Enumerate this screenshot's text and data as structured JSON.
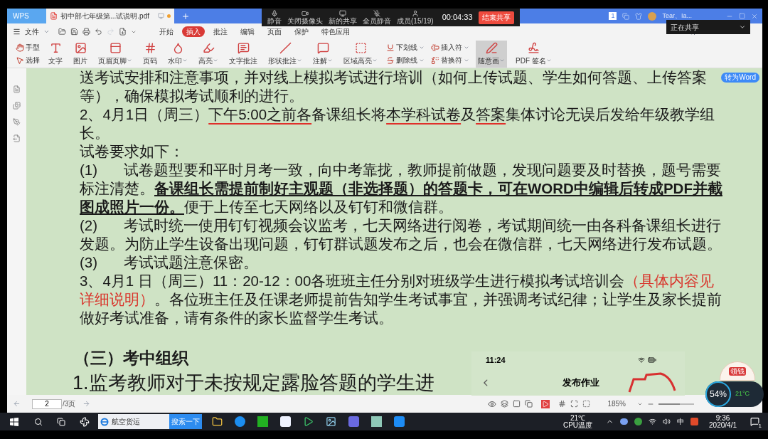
{
  "tabs": [
    {
      "kind": "brand",
      "label": "WPS",
      "selected": false
    },
    {
      "kind": "document",
      "label": "初中部七年级第...试说明.pdf",
      "selected": true
    }
  ],
  "title_bar": {
    "badge": "1",
    "user": "Tear、Ia..."
  },
  "meeting_bar": {
    "items": [
      "静音",
      "关闭摄像头",
      "新的共享",
      "全员静音",
      "成员(15/19)"
    ],
    "timer": "00:04:33",
    "end_button": "结束共享",
    "sharing_label": "正在共享"
  },
  "menu": {
    "file": "文件",
    "items": [
      {
        "label": "开始",
        "selected": false
      },
      {
        "label": "插入",
        "selected": true
      },
      {
        "label": "批注",
        "selected": false
      },
      {
        "label": "编辑",
        "selected": false
      },
      {
        "label": "页面",
        "selected": false
      },
      {
        "label": "保护",
        "selected": false
      },
      {
        "label": "特色应用",
        "selected": false
      }
    ]
  },
  "toolbar": [
    {
      "kind": "stack",
      "items": [
        {
          "label": "手型",
          "dropdown": false
        },
        {
          "label": "选择",
          "dropdown": false
        }
      ]
    },
    {
      "kind": "large",
      "label": "文字",
      "dropdown": false,
      "selected": false
    },
    {
      "kind": "large",
      "label": "图片",
      "dropdown": false,
      "selected": false
    },
    {
      "kind": "large",
      "label": "页眉页脚",
      "dropdown": true,
      "selected": false
    },
    {
      "kind": "large",
      "label": "页码",
      "dropdown": false,
      "selected": false
    },
    {
      "kind": "large",
      "label": "水印",
      "dropdown": true,
      "selected": false
    },
    {
      "kind": "large",
      "label": "高亮",
      "dropdown": true,
      "selected": false
    },
    {
      "kind": "large",
      "label": "文字批注",
      "dropdown": false,
      "selected": false
    },
    {
      "kind": "large",
      "label": "形状批注",
      "dropdown": true,
      "selected": false
    },
    {
      "kind": "large",
      "label": "注解",
      "dropdown": true,
      "selected": false
    },
    {
      "kind": "large",
      "label": "区域高亮",
      "dropdown": true,
      "selected": false
    },
    {
      "kind": "stack",
      "items": [
        {
          "label": "下划线",
          "dropdown": true
        },
        {
          "label": "删除线",
          "dropdown": true
        }
      ]
    },
    {
      "kind": "stack",
      "items": [
        {
          "label": "插入符",
          "dropdown": true
        },
        {
          "label": "替换符",
          "dropdown": true
        }
      ]
    },
    {
      "kind": "large",
      "label": "随意画",
      "dropdown": true,
      "selected": true
    },
    {
      "kind": "large",
      "label": "PDF 签名",
      "dropdown": true,
      "selected": false
    }
  ],
  "convert_button": "转为Word",
  "document": {
    "paragraphs": [
      {
        "kind": "body",
        "segments": [
          {
            "text": "送考试安排和注意事项，并对线上模拟考试进行培训（如何上传试题、学生如何答题、上传答案等），确保模拟考试顺利的进行。",
            "kind": "plain"
          }
        ]
      },
      {
        "kind": "body",
        "segments": [
          {
            "text": "2、4月1日（周三）",
            "kind": "plain"
          },
          {
            "text": "下午5:00之前各",
            "kind": "marked"
          },
          {
            "text": "备课组长将",
            "kind": "plain"
          },
          {
            "text": "本学科试卷",
            "kind": "marked"
          },
          {
            "text": "及",
            "kind": "plain"
          },
          {
            "text": "答案",
            "kind": "marked"
          },
          {
            "text": "集体讨论无误后发给年级教学组长。",
            "kind": "plain"
          }
        ]
      },
      {
        "kind": "body",
        "segments": [
          {
            "text": "试卷要求如下：",
            "kind": "plain"
          }
        ]
      },
      {
        "kind": "item",
        "number": "(1)",
        "segments": [
          {
            "text": "试卷题型要和平时月考一致，向中考靠拢，教师提前做题，发现问题要及时替换，题号需要标注清楚。",
            "kind": "plain"
          },
          {
            "text": "备课组长需提前制好主观题（非选择题）的答题卡，可在WORD中编辑后转成PDF并截图成照片一份。",
            "kind": "bold"
          },
          {
            "text": "便于上传至七天网络以及钉钉和微信群。",
            "kind": "plain"
          }
        ]
      },
      {
        "kind": "item",
        "number": "(2)",
        "segments": [
          {
            "text": "考试时统一使用钉钉视频会议监考，七天网络进行阅卷，考试期间统一由各科备课组长进行发题。为防止学生设备出现问题，钉钉群试题发布之后，也会在微信群，七天网络进行发布试题。",
            "kind": "plain"
          }
        ]
      },
      {
        "kind": "item",
        "number": "(3)",
        "segments": [
          {
            "text": "考试试题注意保密。",
            "kind": "plain"
          }
        ]
      },
      {
        "kind": "body",
        "segments": [
          {
            "text": "3、4月1 日（周三）11：20-12：00各班班主任分别对班级学生进行模拟考试培训会",
            "kind": "plain"
          },
          {
            "text": "（具体内容见详细说明）",
            "kind": "red"
          },
          {
            "text": "。各位班主任及任课老师提前告知学生考试事宜，并强调考试纪律；让学生及家长提前做好考试准备，请有条件的家长监督学生考试。",
            "kind": "plain"
          }
        ]
      },
      {
        "kind": "heading",
        "segments": [
          {
            "text": "（三）考中组织",
            "kind": "plain"
          }
        ]
      },
      {
        "kind": "large",
        "segments": [
          {
            "text": "1.监考教师对于未按规定露脸答题的学生进",
            "kind": "plain"
          }
        ]
      }
    ]
  },
  "phone_overlay": {
    "time": "11:24",
    "title": "发布作业"
  },
  "widgets": {
    "gift_label": "领钱",
    "cpu_load": "54%",
    "cpu_temp": "21°C"
  },
  "status_bar": {
    "page": "2",
    "page_total": "/3页",
    "zoom": "185%",
    "zoom_slider": {
      "level": 0.6
    }
  },
  "taskbar": {
    "search_text": "航空货运",
    "search_button": "搜索一下",
    "temp": "21℃",
    "temp_label": "CPU温度",
    "ime": "中",
    "time": "9:36",
    "date": "2020/4/1",
    "notifications": "1"
  }
}
